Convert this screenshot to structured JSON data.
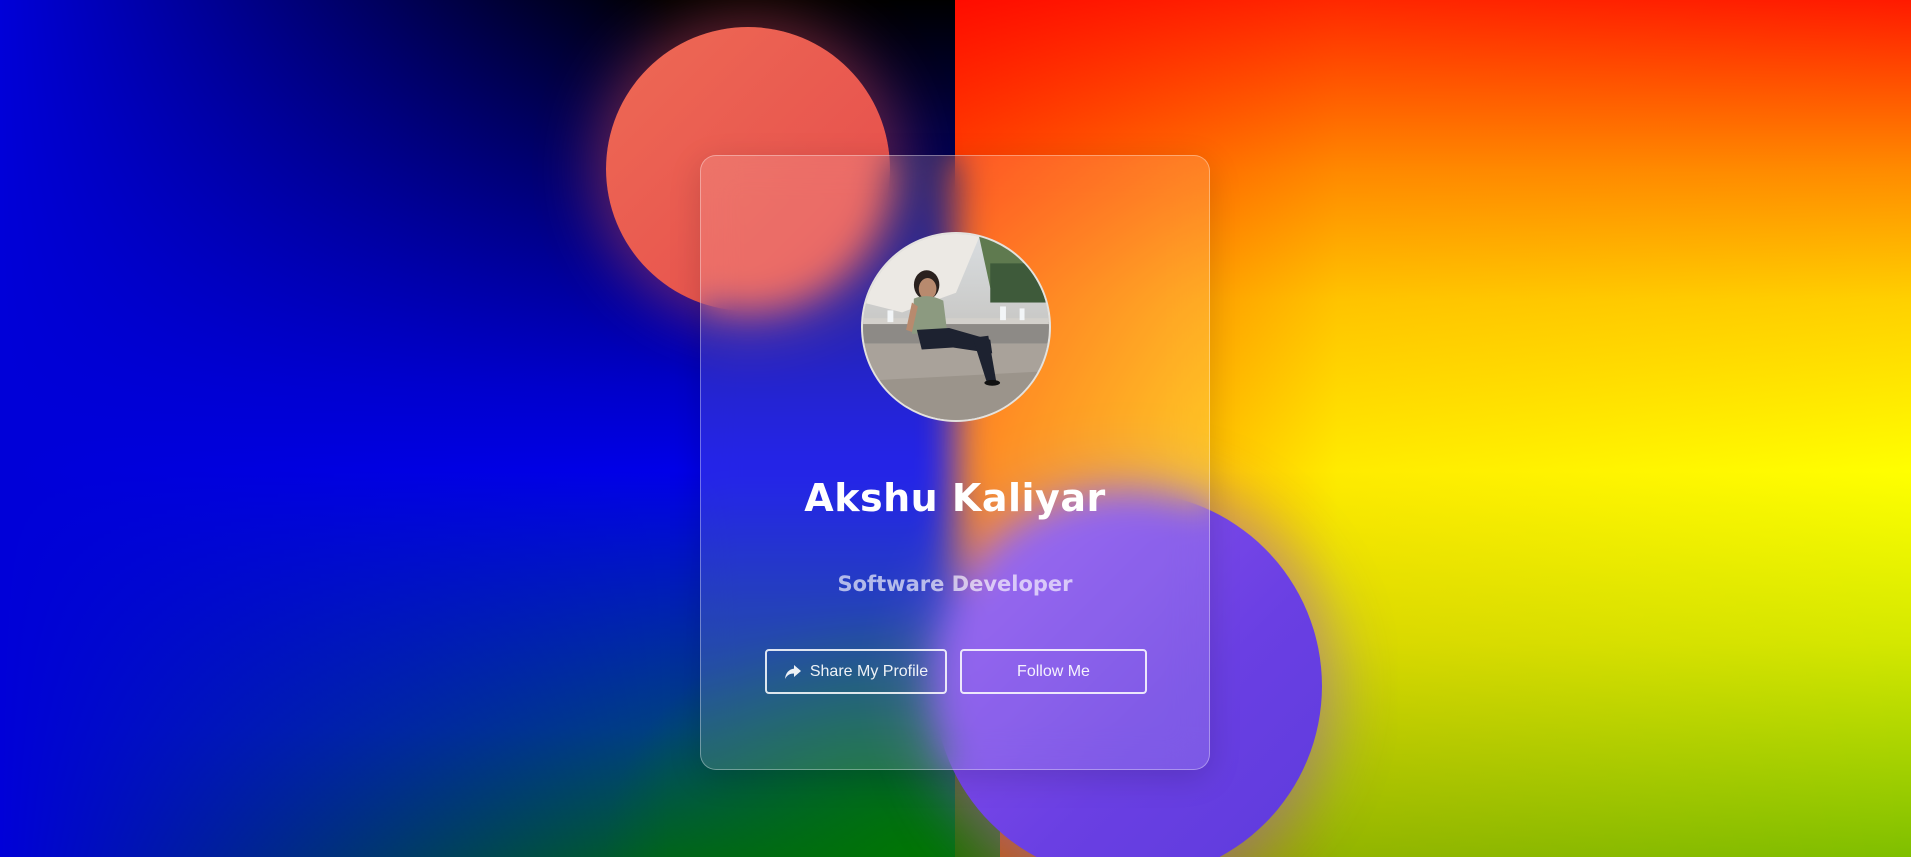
{
  "profile": {
    "name": "Akshu Kaliyar",
    "role": "Software Developer",
    "avatar_alt": "profile-photo"
  },
  "actions": {
    "share_label": "Share My Profile",
    "follow_label": "Follow Me",
    "share_icon": "share-icon"
  },
  "colors": {
    "left_background": "#0000e8",
    "right_background": "#ffd000",
    "top_blob": "#e85a50",
    "bottom_blob": "#7a4aec",
    "text_primary": "#ffffff"
  }
}
